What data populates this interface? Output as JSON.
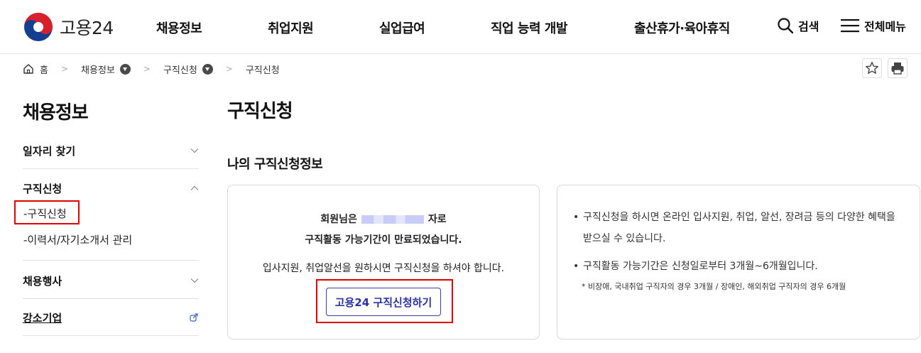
{
  "header": {
    "logo_text": "고용24",
    "nav": [
      "채용정보",
      "취업지원",
      "실업급여",
      "직업 능력 개발",
      "출산휴가·육아휴직"
    ],
    "search_label": "검색",
    "menu_label": "전체메뉴"
  },
  "breadcrumb": {
    "home": "홈",
    "level1": "채용정보",
    "level2": "구직신청",
    "current": "구직신청"
  },
  "sidebar": {
    "title": "채용정보",
    "sections": [
      {
        "label": "일자리 찾기",
        "state": "collapsed"
      },
      {
        "label": "구직신청",
        "state": "expanded",
        "children": [
          "-구직신청",
          "-이력서/자기소개서 관리"
        ]
      },
      {
        "label": "채용행사",
        "state": "collapsed"
      },
      {
        "label": "강소기업",
        "state": "external-link"
      }
    ]
  },
  "main": {
    "page_title": "구직신청",
    "section_title": "나의 구직신청정보",
    "status_card": {
      "line1_prefix": "회원님은",
      "line1_suffix": "자로",
      "line2": "구직활동 가능기간이 만료되었습니다.",
      "line3": "입사지원, 취업알선을 원하시면 구직신청을 하셔야 합니다.",
      "button_label": "고용24 구직신청하기"
    },
    "info_card": {
      "bullets": [
        "구직신청을 하시면 온라인 입사지원, 취업, 알선, 장려금 등의 다양한 혜택을 받으실 수 있습니다.",
        "구직활동 가능기간은 신청일로부터 3개월~6개월입니다."
      ],
      "note": "* 비장애, 국내취업 구직자의 경우 3개월 / 장애인, 해외취업 구직자의 경우 6개월"
    }
  },
  "colors": {
    "highlight_border": "#e00000",
    "button_text": "#2b33a5",
    "logo_red": "#d6202c",
    "logo_blue": "#143e8f"
  }
}
